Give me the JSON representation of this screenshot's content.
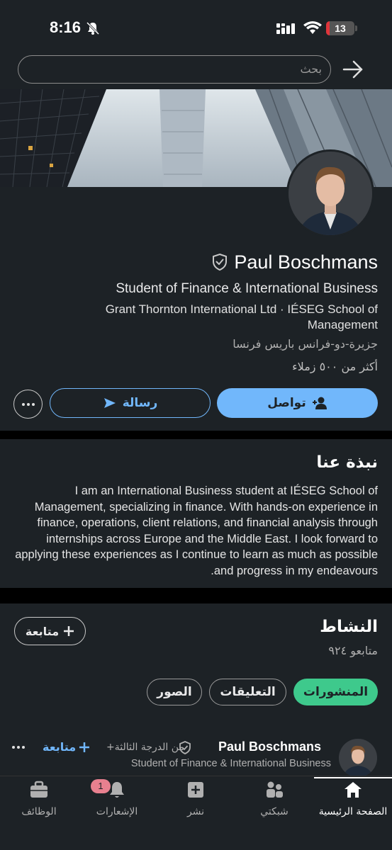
{
  "status_bar": {
    "time": "8:16",
    "battery": "13",
    "battery_fraction": 0.13,
    "icons": [
      "bell-slash-icon",
      "signal-icon",
      "wifi-icon",
      "battery-icon"
    ]
  },
  "search": {
    "placeholder": "بحث"
  },
  "profile": {
    "name": "Paul Boschmans",
    "headline": "Student of Finance & International Business",
    "company": "Grant Thornton International Ltd · IÉSEG School of Management",
    "location": "جزيرة-دو-فرانس باريس فرنسا",
    "connections": "أكثر من ٥٠٠ زملاء",
    "connect_label": "تواصل",
    "message_label": "رسالة"
  },
  "about": {
    "title": "نبذة عنا",
    "text": "I am an International Business student at IÉSEG School of Management, specializing in finance. With hands-on experience in finance, operations, client relations, and financial analysis through internships across Europe and the Middle East. I look forward to applying these experiences as I continue to learn as much as possible and progress in my endeavours."
  },
  "activity": {
    "title": "النشاط",
    "followers": "متابعو ٩٢٤",
    "follow_label": "متابعة",
    "tabs": [
      {
        "label": "المنشورات",
        "active": true
      },
      {
        "label": "التعليقات",
        "active": false
      },
      {
        "label": "الصور",
        "active": false
      }
    ],
    "post": {
      "author": "Paul Boschmans",
      "degree": "من الدرجة الثالثة+",
      "headline": "Student of Finance & International Business",
      "follow_label": "متابعة"
    }
  },
  "bottom_nav": {
    "items": [
      {
        "label": "الصفحة الرئيسية",
        "icon": "home-icon",
        "active": true
      },
      {
        "label": "شبكتي",
        "icon": "network-icon",
        "active": false
      },
      {
        "label": "نشر",
        "icon": "post-icon",
        "active": false
      },
      {
        "label": "الإشعارات",
        "icon": "bell-icon",
        "active": false,
        "badge": "1"
      },
      {
        "label": "الوظائف",
        "icon": "briefcase-icon",
        "active": false
      }
    ]
  },
  "colors": {
    "background": "#1d2226",
    "accent": "#71b7fb",
    "active_chip": "#3ec98c",
    "badge": "#e8808f"
  }
}
